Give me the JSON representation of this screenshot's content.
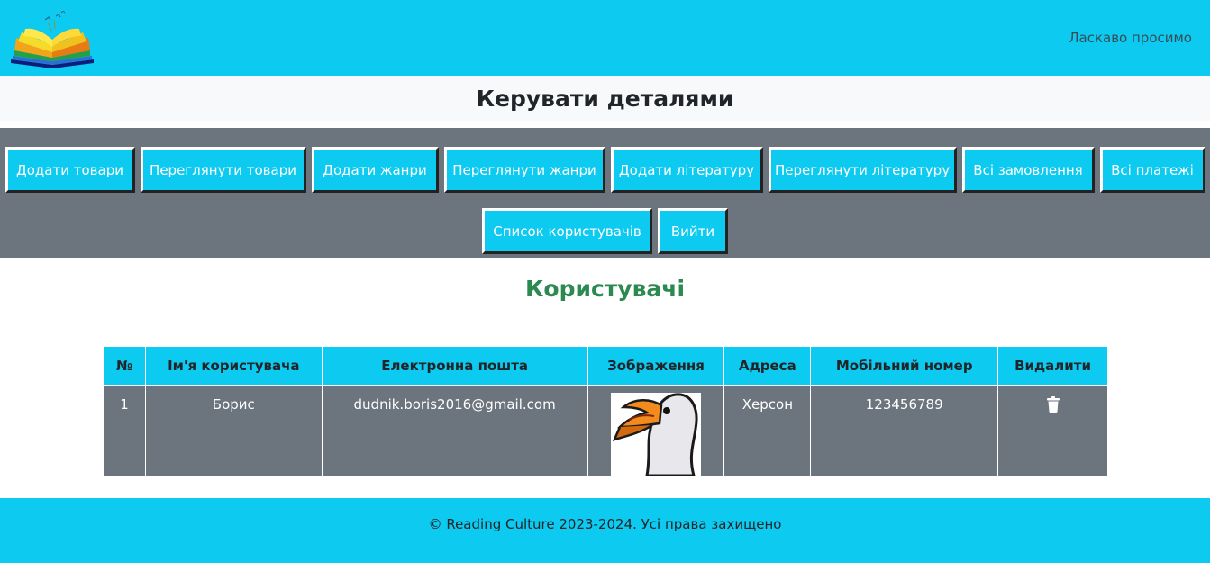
{
  "header": {
    "logo_icon": "open-book-logo-icon",
    "welcome_text": "Ласкаво просимо"
  },
  "manage": {
    "title": "Керувати деталями"
  },
  "nav": {
    "row1": [
      "Додати товари",
      "Переглянути товари",
      "Додати жанри",
      "Переглянути жанри",
      "Додати літературу",
      "Переглянути літературу",
      "Всі замовлення",
      "Всі платежі"
    ],
    "row2": [
      "Список користувачів",
      "Вийти"
    ]
  },
  "users": {
    "title": "Користувачі",
    "columns": [
      "№",
      "Ім'я користувача",
      "Електронна пошта",
      "Зображення",
      "Адреса",
      "Мобільний номер",
      "Видалити"
    ],
    "rows": [
      {
        "num": "1",
        "name": "Борис",
        "email": "dudnik.boris2016@gmail.com",
        "image": "goose-avatar",
        "address": "Херсон",
        "phone": "123456789",
        "delete_icon": "trash-icon"
      }
    ]
  },
  "footer": {
    "text": "© Reading Culture 2023-2024. Усі права захищено"
  },
  "colors": {
    "primary": "#0dcaf0",
    "secondary": "#6c757d",
    "title_green": "#2b8a50",
    "light": "#f8f9fa"
  }
}
